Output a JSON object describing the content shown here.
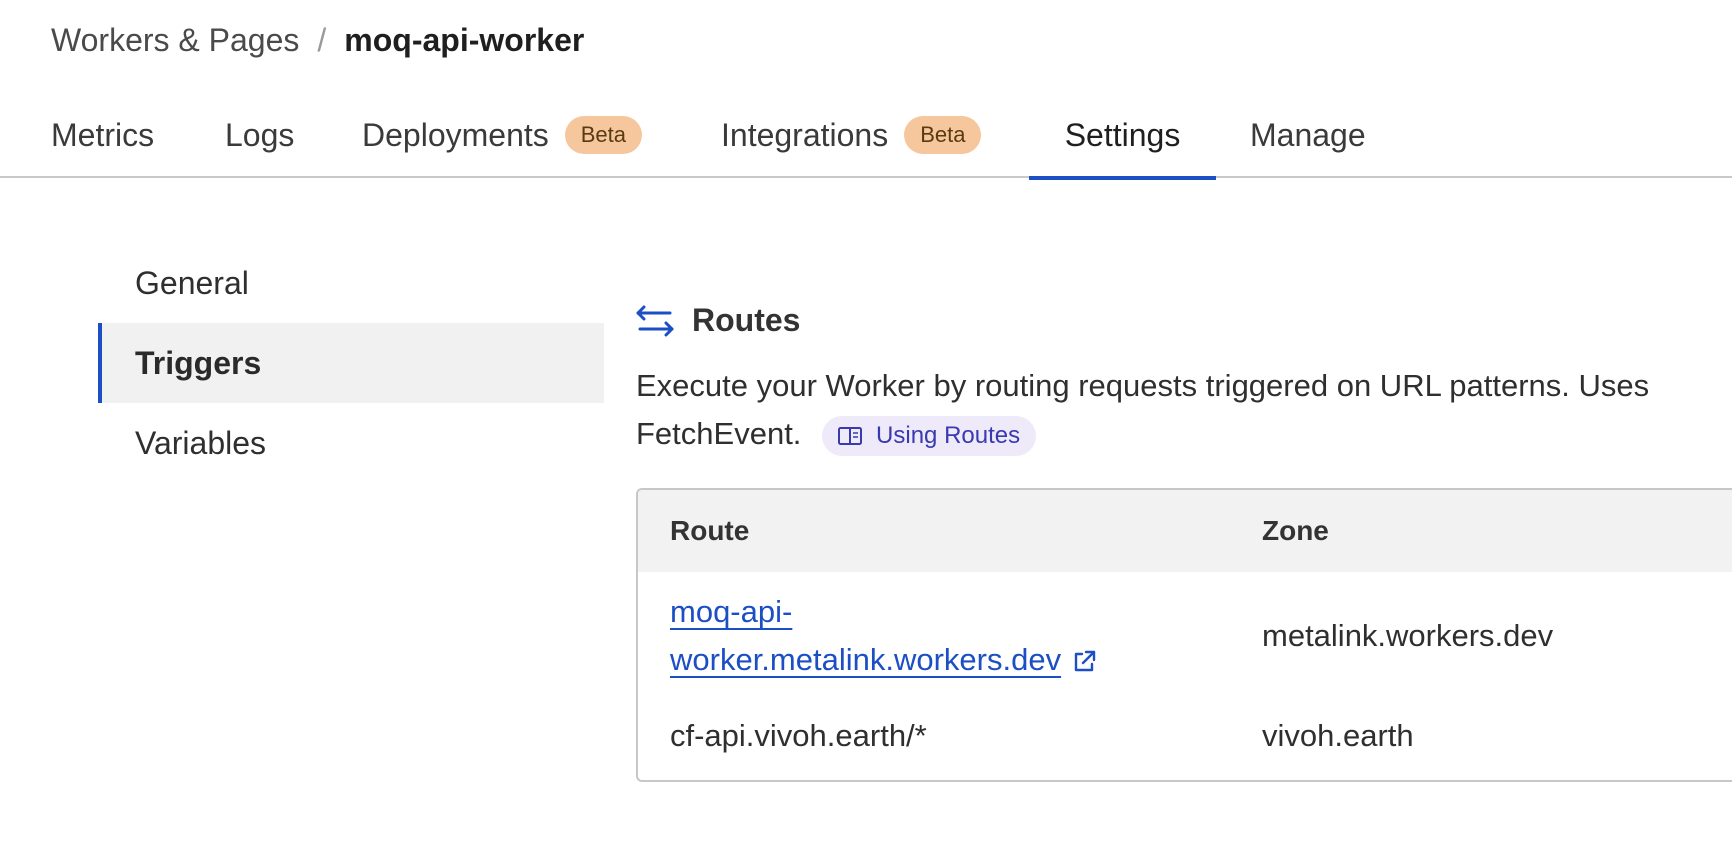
{
  "breadcrumb": {
    "parent": "Workers & Pages",
    "separator": "/",
    "current": "moq-api-worker"
  },
  "tabs": [
    {
      "label": "Metrics"
    },
    {
      "label": "Logs"
    },
    {
      "label": "Deployments",
      "badge": "Beta"
    },
    {
      "label": "Integrations",
      "badge": "Beta"
    },
    {
      "label": "Settings",
      "active": true
    },
    {
      "label": "Manage"
    }
  ],
  "sidenav": {
    "items": [
      {
        "label": "General"
      },
      {
        "label": "Triggers",
        "active": true
      },
      {
        "label": "Variables"
      }
    ]
  },
  "routes": {
    "icon": "arrows-swap-icon",
    "title": "Routes",
    "description": "Execute your Worker by routing requests triggered on URL patterns. Uses FetchEvent.",
    "doc_link": {
      "icon": "book-icon",
      "label": "Using Routes"
    },
    "table": {
      "headers": {
        "route": "Route",
        "zone": "Zone"
      },
      "rows": [
        {
          "route_line1": "moq-api-",
          "route_line2": "worker.metalink.workers.dev",
          "zone": "metalink.workers.dev",
          "link": true
        },
        {
          "route": "cf-api.vivoh.earth/*",
          "zone": "vivoh.earth"
        }
      ]
    }
  },
  "colors": {
    "accent": "#1d4fc4",
    "badge_bg": "#f6c79c",
    "doc_link_bg": "#eeeaf9",
    "doc_link_text": "#3a3ab0"
  }
}
